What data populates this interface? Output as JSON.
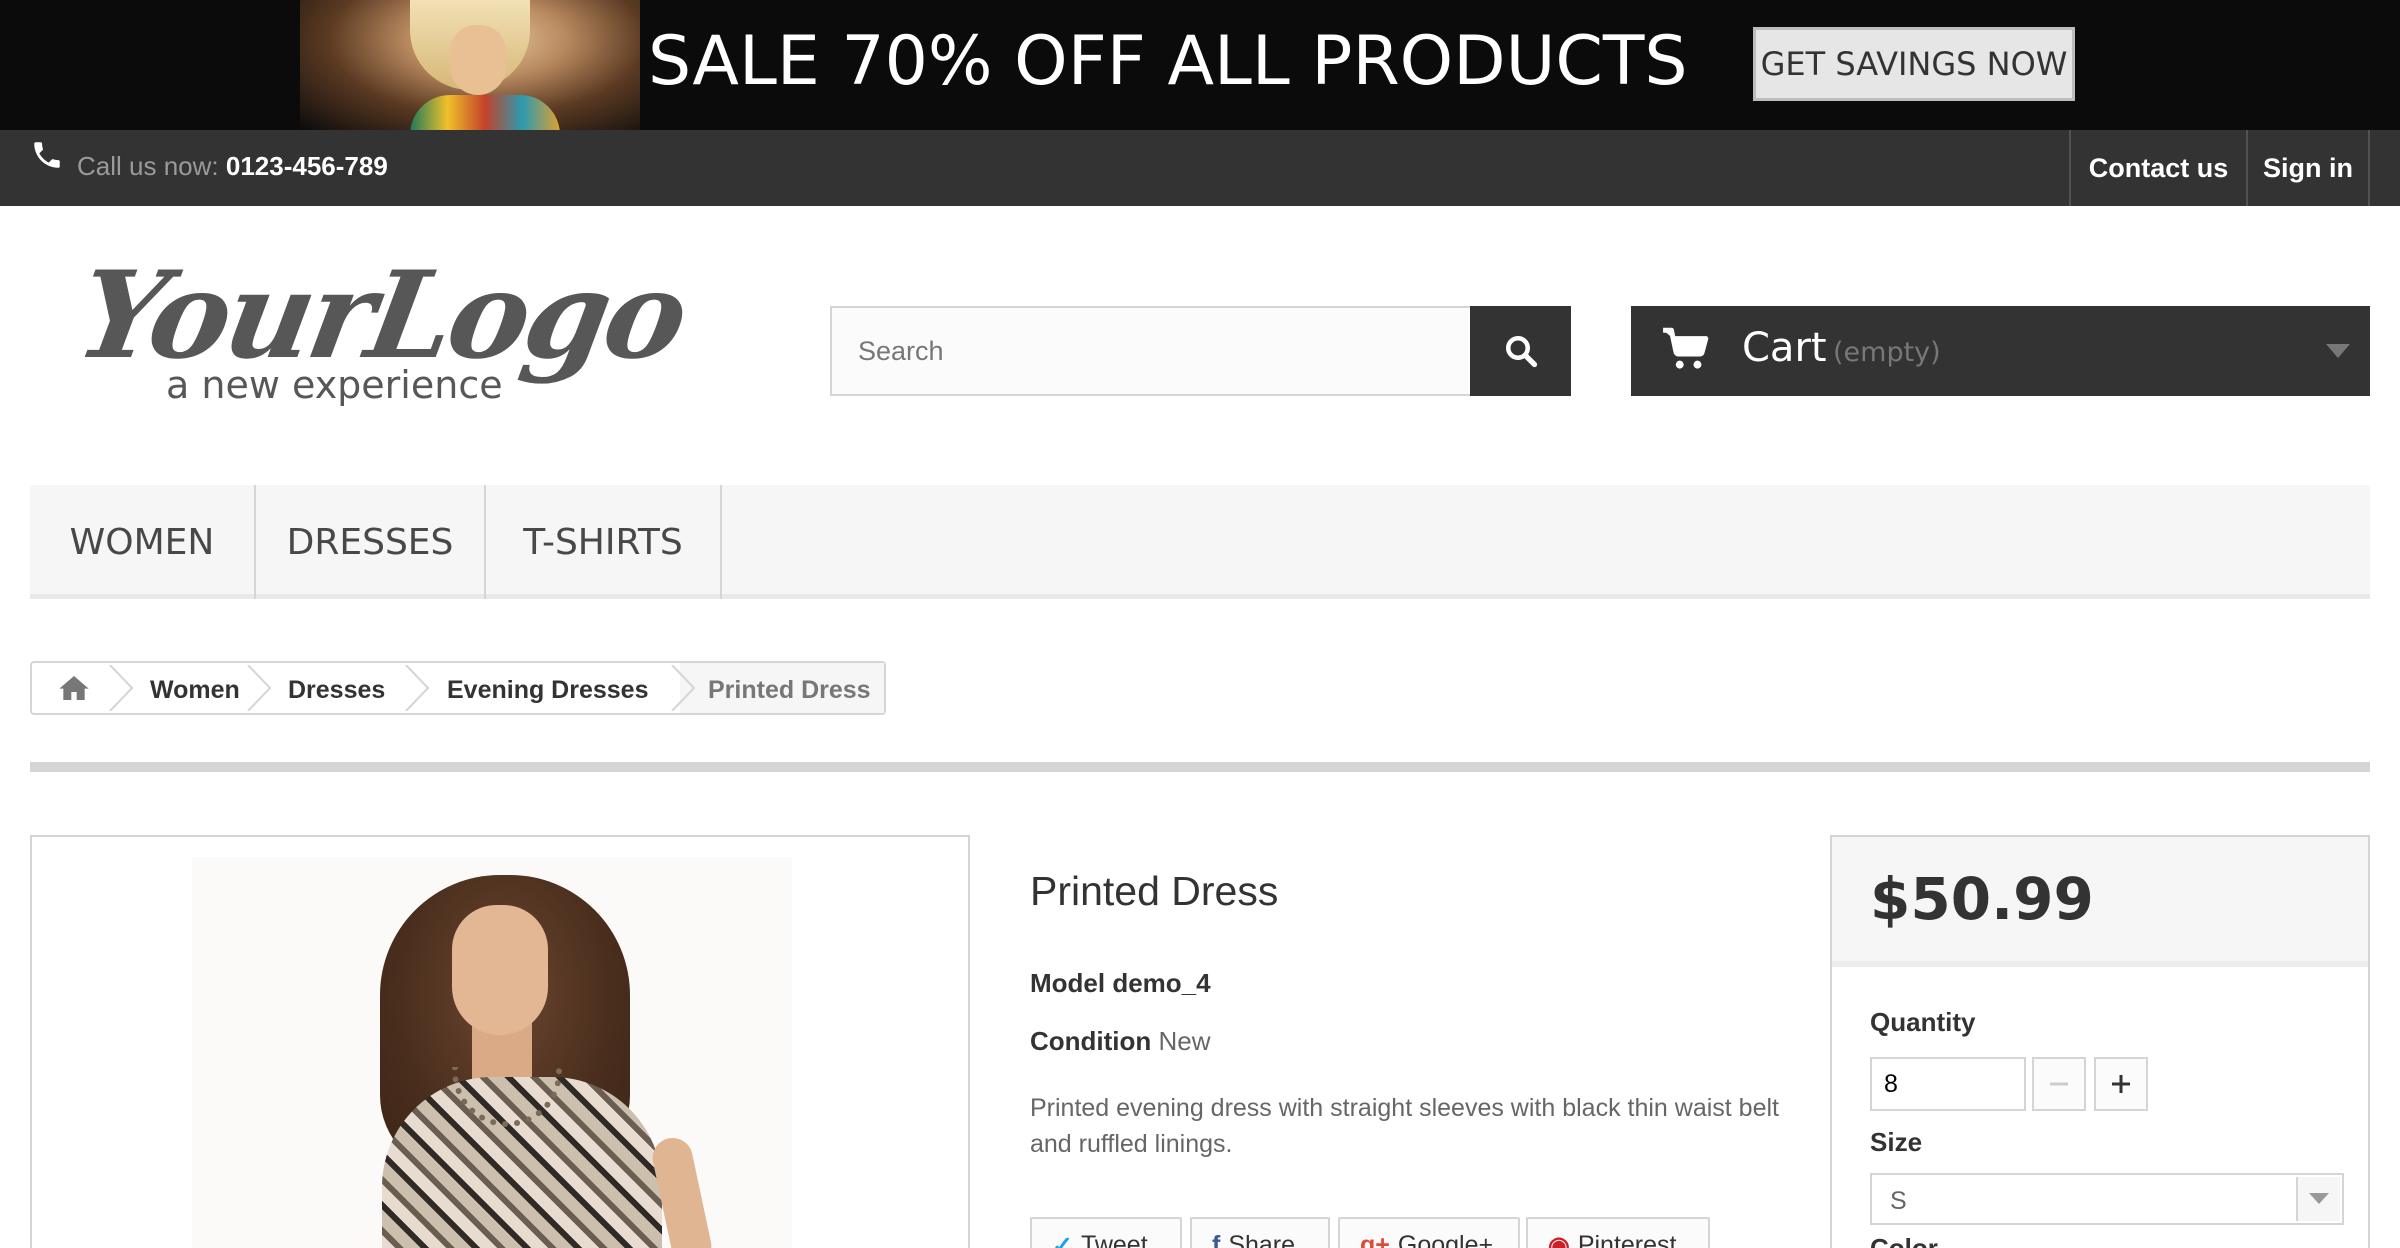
{
  "banner": {
    "headline": "SALE 70% OFF ALL PRODUCTS",
    "button_label": "GET SAVINGS NOW"
  },
  "topbar": {
    "call_prefix": "Call us now:",
    "phone": "0123-456-789",
    "contact_label": "Contact us",
    "signin_label": "Sign in",
    "phone_icon": "phone-icon"
  },
  "header": {
    "logo_script": "YourLogo",
    "logo_tagline": "a new experience",
    "search_placeholder": "Search",
    "search_value": "",
    "cart_label": "Cart",
    "cart_status": "(empty)"
  },
  "menu": {
    "items": [
      {
        "label": "WOMEN"
      },
      {
        "label": "DRESSES"
      },
      {
        "label": "T-SHIRTS"
      }
    ]
  },
  "breadcrumb": {
    "items": [
      {
        "label": "Women"
      },
      {
        "label": "Dresses"
      },
      {
        "label": "Evening Dresses"
      }
    ],
    "current": "Printed Dress"
  },
  "product": {
    "title": "Printed Dress",
    "model_label": "Model",
    "model_value": "demo_4",
    "condition_label": "Condition",
    "condition_value": "New",
    "description": "Printed evening dress with straight sleeves with black thin waist belt and ruffled linings.",
    "share": {
      "tweet": "Tweet",
      "share": "Share",
      "google": "Google+",
      "pinterest": "Pinterest"
    }
  },
  "buybox": {
    "price": "$50.99",
    "quantity_label": "Quantity",
    "quantity_value": "8",
    "size_label": "Size",
    "size_value": "S",
    "color_label": "Color"
  },
  "colors": {
    "dark_bar": "#333333",
    "banner_bg": "#0b0b0b",
    "border": "#d6d4d4",
    "light_bg": "#f6f6f6"
  }
}
